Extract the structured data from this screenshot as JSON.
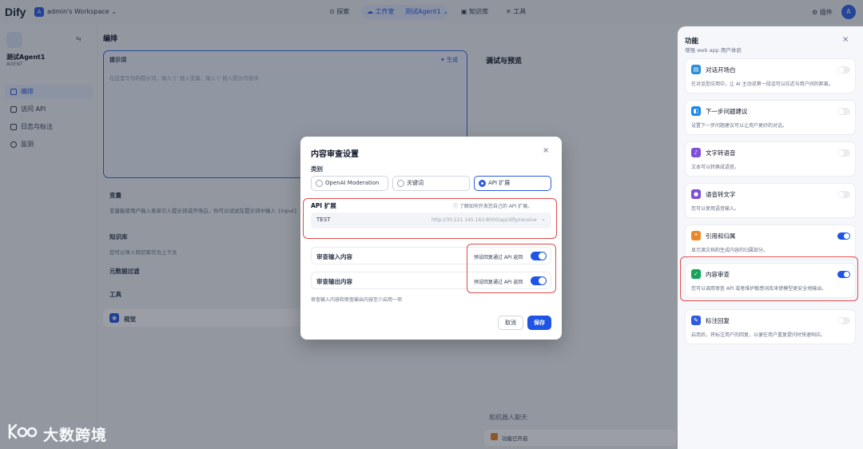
{
  "topbar": {
    "logo": "Dify",
    "workspace_initial": "A",
    "workspace_name": "admin's Workspace",
    "nav": {
      "explore": "探索",
      "studio": "工作室",
      "app": "测试Agent1",
      "knowledge": "知识库",
      "tools": "工具"
    },
    "plugins": "插件",
    "user_initial": "A"
  },
  "sidebar": {
    "app_name": "测试Agent1",
    "app_type": "AGENT",
    "items": [
      {
        "label": "编排",
        "active": true
      },
      {
        "label": "访问 API",
        "active": false
      },
      {
        "label": "日志与标注",
        "active": false
      },
      {
        "label": "监测",
        "active": false
      }
    ]
  },
  "main": {
    "title": "编排",
    "prompt": {
      "label": "提示词",
      "generate": "生成",
      "placeholder": "在这里写你的提示词，输入'{' 插入变量、输入'/' 插入提示内容块"
    },
    "variables": {
      "label": "变量",
      "desc": "变量能使用户输入表单引入提示词或开场白，你可以试试在提示词中输入 {input}"
    },
    "knowledge": {
      "label": "知识库",
      "desc": "您可以导入知识库作为上下文"
    },
    "metadata_filter": "元数据过滤",
    "tools": "工具",
    "vision": "视觉"
  },
  "debug": {
    "title": "调试与预览",
    "chat_title": "和机器人聊天",
    "feature_enabled": "功能已开启"
  },
  "features": {
    "title": "功能",
    "subtitle": "增强 web app 用户体验",
    "close": "×",
    "items": [
      {
        "name": "对话开场白",
        "desc": "在对话型应用中，让 AI 主动说第一段话可以拉近与用户间的距离。",
        "enabled": false,
        "color": "#2b8fd6"
      },
      {
        "name": "下一步问题建议",
        "desc": "设置下一步问题建议可以让用户更好的对话。",
        "enabled": false,
        "color": "#1e88e5"
      },
      {
        "name": "文字转语音",
        "desc": "文本可以转换成语音。",
        "enabled": false,
        "color": "#7e4fd8"
      },
      {
        "name": "语音转文字",
        "desc": "您可以使用语音输入。",
        "enabled": false,
        "color": "#7e4fd8"
      },
      {
        "name": "引用和归属",
        "desc": "显示源文档和生成内容的归属部分。",
        "enabled": true,
        "color": "#e8882b"
      },
      {
        "name": "内容审查",
        "desc": "您可以调用审查 API 或者维护敏感词库来使模型更安全地输出。",
        "enabled": true,
        "color": "#16a35a"
      },
      {
        "name": "标注回复",
        "desc": "启用后，将标注用户的回复，以便在用户重复提问时快速响应。",
        "enabled": false,
        "color": "#2d5be3"
      }
    ]
  },
  "modal": {
    "title": "内容审查设置",
    "close": "×",
    "category_label": "类别",
    "options": [
      {
        "label": "OpenAI Moderation",
        "selected": false
      },
      {
        "label": "关键词",
        "selected": false
      },
      {
        "label": "API 扩展",
        "selected": true
      }
    ],
    "api_ext_label": "API 扩展",
    "api_link": "ⓘ 了解如何开发您自己的 API 扩展。",
    "api_selected_name": "TEST",
    "api_selected_url": "http://30.221.145.163:8000/api/dify/receive",
    "input_review": {
      "label": "审查输入内容",
      "preset": "预设回复通过 API 返回",
      "enabled": true
    },
    "output_review": {
      "label": "审查输出内容",
      "preset": "预设回复通过 API 返回",
      "enabled": true
    },
    "note": "审查输入内容和审查输出内容至少启用一项",
    "cancel": "取消",
    "save": "保存"
  },
  "watermark": "大数跨境",
  "colors": {
    "accent": "#1f55e6",
    "highlight_border": "#e14b4b"
  }
}
